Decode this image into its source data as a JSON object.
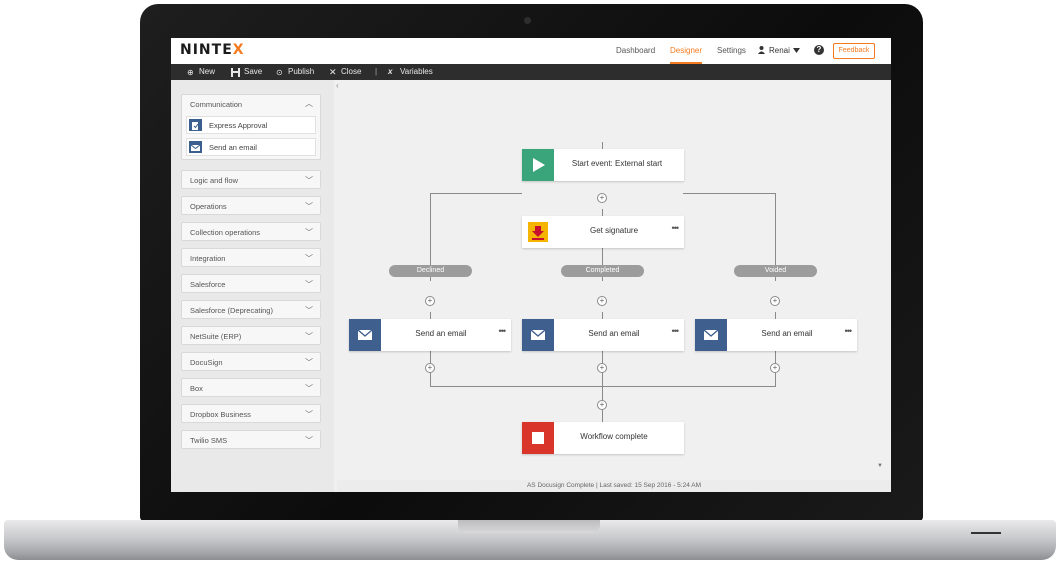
{
  "app": {
    "logo_text": "NINTE",
    "logo_accent": "X",
    "brand_color": "#f47b20"
  },
  "nav": {
    "dashboard": "Dashboard",
    "designer": "Designer",
    "settings": "Settings",
    "user": "Renai",
    "help_icon": "?",
    "feedback": "Feedback"
  },
  "toolbar": {
    "new": "New",
    "save": "Save",
    "publish": "Publish",
    "close": "Close",
    "variables": "Variables"
  },
  "toolbox": {
    "communication": {
      "label": "Communication",
      "items": [
        "Express Approval",
        "Send an email"
      ]
    },
    "groups": [
      "Logic and flow",
      "Operations",
      "Collection operations",
      "Integration",
      "Salesforce",
      "Salesforce (Deprecating)",
      "NetSuite (ERP)",
      "DocuSign",
      "Box",
      "Dropbox Business",
      "Twilio SMS"
    ]
  },
  "workflow": {
    "start": "Start event: External start",
    "signature": "Get signature",
    "branches": [
      "Declined",
      "Completed",
      "Voided"
    ],
    "email": "Send an email",
    "complete": "Workflow complete",
    "more": "•••",
    "plus": "+",
    "icon_colors": {
      "start": "#3aa57a",
      "signature": "#f5b400",
      "email": "#3f5f8e",
      "complete": "#d9352a"
    }
  },
  "status": {
    "text": "AS Docusign Complete  |  Last saved: 15 Sep 2016 - 5:24 AM"
  }
}
